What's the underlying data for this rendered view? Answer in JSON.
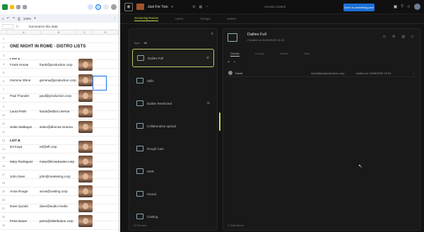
{
  "sheet": {
    "zoom": "100%",
    "summarize": "Summarize this data",
    "title": "ONE NIGHT IN ROME - DISTRO LISTS",
    "list_a": "LIST A",
    "list_b": "LIST B",
    "people_a": [
      {
        "name": "Frank House",
        "email": "frank@production.corp"
      },
      {
        "name": "Gemma Shine",
        "email": "gemma@production.corp"
      },
      {
        "name": "Paul Thunder",
        "email": "paul@production.corp"
      },
      {
        "name": "Laura Palm",
        "email": "laura@editor.cinema"
      },
      {
        "name": "Selen Balbayar",
        "email": "selen@director.cinema"
      }
    ],
    "people_b": [
      {
        "name": "Ed Kaya",
        "email": "ed@sfl.corp"
      },
      {
        "name": "Mary Rodriguez",
        "email": "mary@broadcaster.corp"
      },
      {
        "name": "John Dear",
        "email": "john@marketing.corp"
      },
      {
        "name": "Anna Rouge",
        "email": "anna@casting.corp"
      },
      {
        "name": "Dave Quoda",
        "email": "dave@audio.media"
      },
      {
        "name": "Petra Bauer",
        "email": "petra@distribution.corp"
      }
    ]
  },
  "app": {
    "project": "Just For Two",
    "center_title": "Access Control",
    "invite": "Once is something pen!",
    "tabs": [
      "Screening Rooms",
      "Users",
      "Groups",
      "Invites"
    ],
    "rooms_filter_label": "Type",
    "rooms_filter_value": "All",
    "rooms": [
      {
        "name": "Dailies Full",
        "active": true
      },
      {
        "name": "Stills",
        "active": false
      },
      {
        "name": "Dailies Restricted",
        "active": false
      },
      {
        "name": "Collaborative upload",
        "active": false
      },
      {
        "name": "Rough Cuts",
        "active": false
      },
      {
        "name": "HDR",
        "active": false
      },
      {
        "name": "Sound",
        "active": false
      },
      {
        "name": "Casting",
        "active": false
      }
    ],
    "rooms_count": "24 Rooms",
    "detail": {
      "title": "Dailies Full",
      "subtitle": "Created on 01/04/2025 16:24",
      "tabs": [
        "Guests",
        "Groups",
        "Invites",
        "Stats"
      ],
      "guests": [
        {
          "name": "David",
          "email": "david@justproduction.corp",
          "added": "Added on 10/08/2025 15:24"
        }
      ],
      "footer": "1 Total Items"
    }
  }
}
